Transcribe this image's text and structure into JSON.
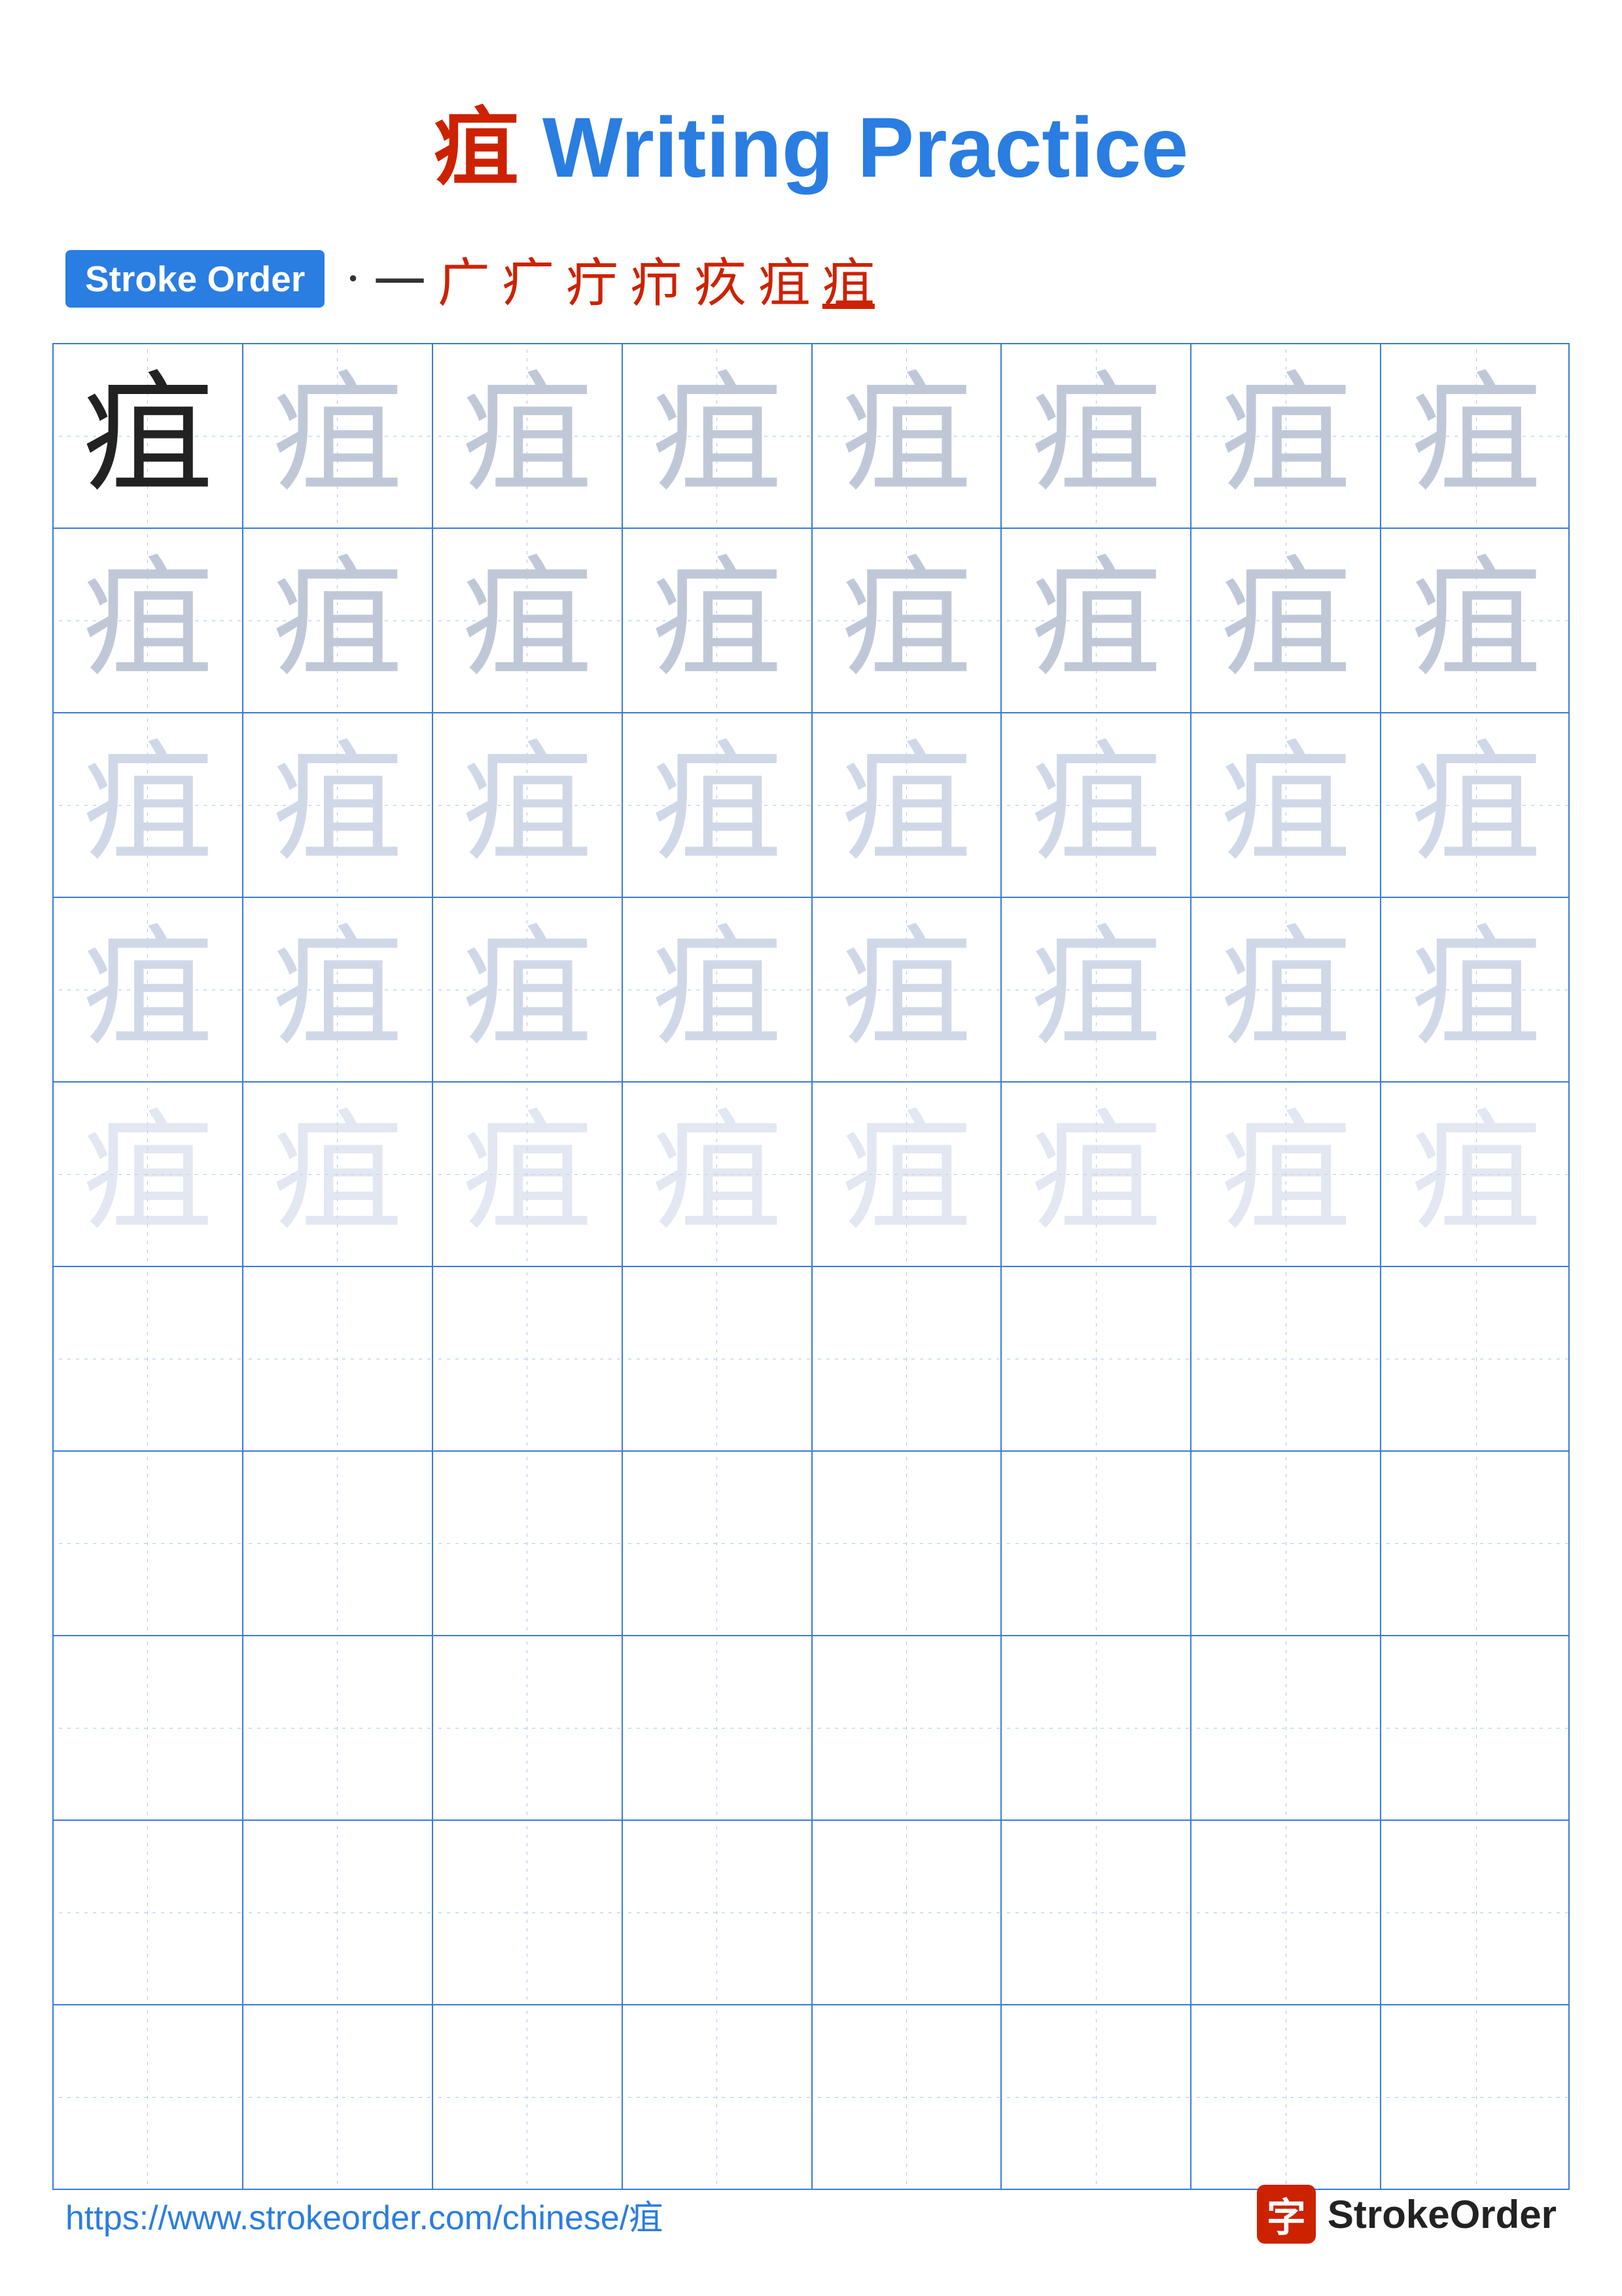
{
  "page": {
    "title_prefix": "疽",
    "title_suffix": " Writing Practice",
    "character": "疽",
    "stroke_order_label": "Stroke Order",
    "stroke_sequence": [
      "·",
      "一",
      "广",
      "广",
      "疒",
      "疔",
      "疖",
      "疚",
      "疽"
    ],
    "footer_url": "https://www.strokeorder.com/chinese/疽",
    "footer_logo_char": "字",
    "footer_logo_name": "StrokeOrder",
    "rows": 10,
    "cols": 8,
    "practice_rows_with_char": 5,
    "practice_rows_empty": 5
  }
}
